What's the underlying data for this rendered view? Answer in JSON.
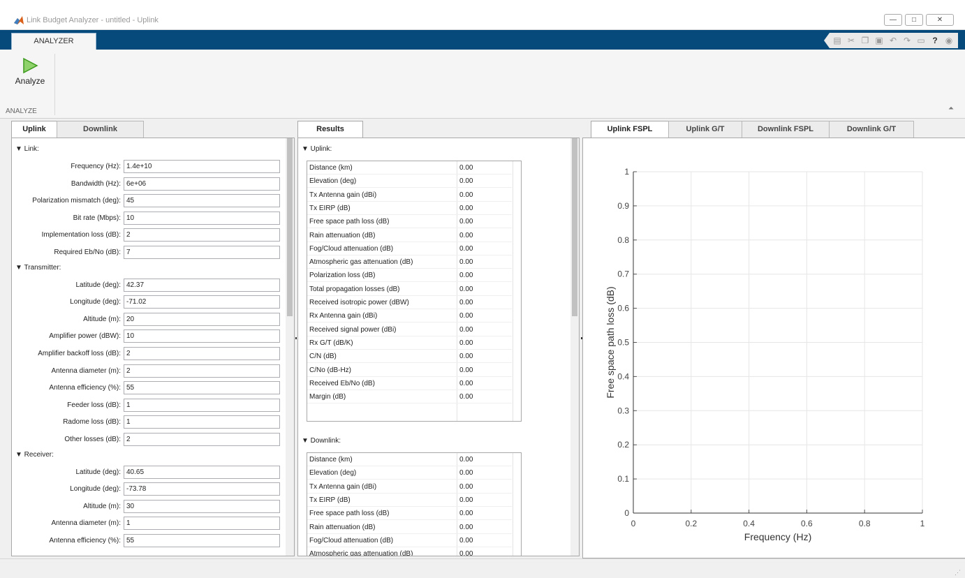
{
  "window": {
    "title": "Link Budget Analyzer - untitled - Uplink",
    "minimize": "—",
    "maximize": "□",
    "close": "✕"
  },
  "ribbon": {
    "tab": "ANALYZER",
    "analyze_label": "Analyze",
    "section_label": "ANALYZE",
    "qat_icons": [
      "save-icon",
      "cut-icon",
      "copy-icon",
      "paste-icon",
      "undo-icon",
      "redo-icon",
      "window-icon",
      "help-icon",
      "menu-icon"
    ]
  },
  "left": {
    "tabs": [
      "Uplink",
      "Downlink"
    ],
    "link": {
      "header": "▼ Link:",
      "fields": [
        {
          "label": "Frequency (Hz):",
          "value": "1.4e+10"
        },
        {
          "label": "Bandwidth (Hz):",
          "value": "6e+06"
        },
        {
          "label": "Polarization mismatch (deg):",
          "value": "45"
        },
        {
          "label": "Bit rate (Mbps):",
          "value": "10"
        },
        {
          "label": "Implementation loss (dB):",
          "value": "2"
        },
        {
          "label": "Required Eb/No (dB):",
          "value": "7"
        }
      ]
    },
    "transmitter": {
      "header": "▼ Transmitter:",
      "fields": [
        {
          "label": "Latitude (deg):",
          "value": "42.37"
        },
        {
          "label": "Longitude (deg):",
          "value": "-71.02"
        },
        {
          "label": "Altitude (m):",
          "value": "20"
        },
        {
          "label": "Amplifier power (dBW):",
          "value": "10"
        },
        {
          "label": "Amplifier backoff loss (dB):",
          "value": "2"
        },
        {
          "label": "Antenna diameter (m):",
          "value": "2"
        },
        {
          "label": "Antenna efficiency (%):",
          "value": "55"
        },
        {
          "label": "Feeder loss (dB):",
          "value": "1"
        },
        {
          "label": "Radome loss (dB):",
          "value": "1"
        },
        {
          "label": "Other losses (dB):",
          "value": "2"
        }
      ]
    },
    "receiver": {
      "header": "▼ Receiver:",
      "fields": [
        {
          "label": "Latitude (deg):",
          "value": "40.65"
        },
        {
          "label": "Longitude (deg):",
          "value": "-73.78"
        },
        {
          "label": "Altitude (m):",
          "value": "30"
        },
        {
          "label": "Antenna diameter (m):",
          "value": "1"
        },
        {
          "label": "Antenna efficiency (%):",
          "value": "55"
        }
      ]
    }
  },
  "results": {
    "tab": "Results",
    "uplink_header": "▼ Uplink:",
    "uplink_rows": [
      {
        "name": "Distance (km)",
        "value": "0.00"
      },
      {
        "name": "Elevation (deg)",
        "value": "0.00"
      },
      {
        "name": "Tx Antenna gain (dBi)",
        "value": "0.00"
      },
      {
        "name": "Tx EIRP (dB)",
        "value": "0.00"
      },
      {
        "name": "Free space path loss (dB)",
        "value": "0.00"
      },
      {
        "name": "Rain attenuation (dB)",
        "value": "0.00"
      },
      {
        "name": "Fog/Cloud attenuation (dB)",
        "value": "0.00"
      },
      {
        "name": "Atmospheric gas attenuation (dB)",
        "value": "0.00"
      },
      {
        "name": "Polarization loss (dB)",
        "value": "0.00"
      },
      {
        "name": "Total propagation losses (dB)",
        "value": "0.00"
      },
      {
        "name": "Received isotropic power (dBW)",
        "value": "0.00"
      },
      {
        "name": "Rx Antenna gain (dBi)",
        "value": "0.00"
      },
      {
        "name": "Received signal power (dBi)",
        "value": "0.00"
      },
      {
        "name": "Rx G/T (dB/K)",
        "value": "0.00"
      },
      {
        "name": "C/N (dB)",
        "value": "0.00"
      },
      {
        "name": "C/No (dB-Hz)",
        "value": "0.00"
      },
      {
        "name": "Received Eb/No (dB)",
        "value": "0.00"
      },
      {
        "name": "Margin (dB)",
        "value": "0.00"
      }
    ],
    "downlink_header": "▼ Downlink:",
    "downlink_rows": [
      {
        "name": "Distance (km)",
        "value": "0.00"
      },
      {
        "name": "Elevation (deg)",
        "value": "0.00"
      },
      {
        "name": "Tx Antenna gain (dBi)",
        "value": "0.00"
      },
      {
        "name": "Tx EIRP (dB)",
        "value": "0.00"
      },
      {
        "name": "Free space path loss (dB)",
        "value": "0.00"
      },
      {
        "name": "Rain attenuation (dB)",
        "value": "0.00"
      },
      {
        "name": "Fog/Cloud attenuation (dB)",
        "value": "0.00"
      },
      {
        "name": "Atmospheric gas attenuation (dB)",
        "value": "0.00"
      }
    ]
  },
  "plot_tabs": [
    "Uplink FSPL",
    "Uplink G/T",
    "Downlink FSPL",
    "Downlink G/T"
  ],
  "chart_data": {
    "type": "line",
    "series": [],
    "xlabel": "Frequency (Hz)",
    "ylabel": "Free space path loss (dB)",
    "xlim": [
      0,
      1
    ],
    "ylim": [
      0,
      1
    ],
    "xticks": [
      "0",
      "0.2",
      "0.4",
      "0.6",
      "0.8",
      "1"
    ],
    "yticks": [
      "0",
      "0.1",
      "0.2",
      "0.3",
      "0.4",
      "0.5",
      "0.6",
      "0.7",
      "0.8",
      "0.9",
      "1"
    ],
    "grid": true
  }
}
